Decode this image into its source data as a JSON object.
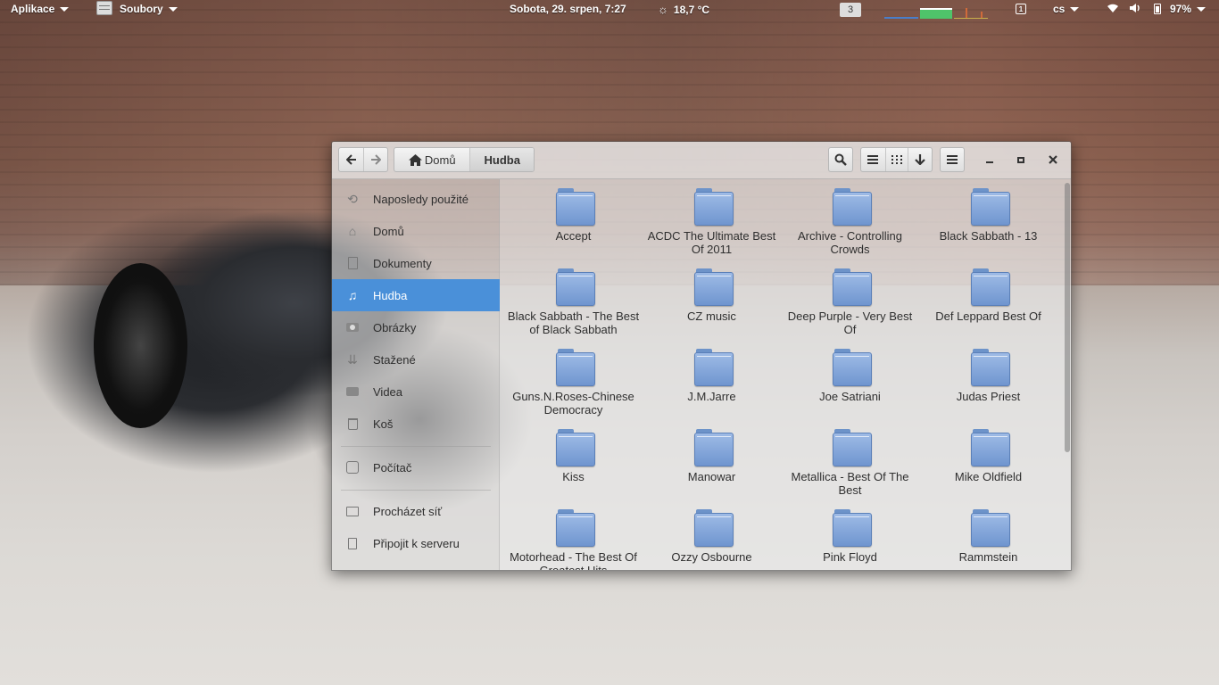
{
  "topbar": {
    "applications": "Aplikace",
    "files": "Soubory",
    "clock": "Sobota, 29. srpen,  7:27",
    "weather": "18,7 °C",
    "workspace": "3",
    "language": "cs",
    "battery": "97%"
  },
  "window": {
    "breadcrumb": {
      "home": "Domů",
      "current": "Hudba"
    }
  },
  "sidebar": {
    "items": [
      {
        "label": "Naposledy použité",
        "icon": "recent-icon"
      },
      {
        "label": "Domů",
        "icon": "home-icon"
      },
      {
        "label": "Dokumenty",
        "icon": "document-icon"
      },
      {
        "label": "Hudba",
        "icon": "music-icon"
      },
      {
        "label": "Obrázky",
        "icon": "camera-icon"
      },
      {
        "label": "Stažené",
        "icon": "download-icon"
      },
      {
        "label": "Videa",
        "icon": "video-icon"
      },
      {
        "label": "Koš",
        "icon": "trash-icon"
      },
      {
        "label": "Počítač",
        "icon": "computer-icon"
      },
      {
        "label": "Procházet síť",
        "icon": "network-icon"
      },
      {
        "label": "Připojit k serveru",
        "icon": "server-icon"
      }
    ]
  },
  "folders": [
    "Accept",
    "ACDC The Ultimate Best Of 2011",
    "Archive - Controlling Crowds",
    "Black Sabbath - 13",
    "Black Sabbath - The Best of Black Sabbath",
    "CZ music",
    "Deep Purple - Very Best Of",
    "Def Leppard Best Of",
    "Guns.N.Roses-Chinese Democracy",
    "J.M.Jarre",
    "Joe Satriani",
    "Judas Priest",
    "Kiss",
    "Manowar",
    "Metallica - Best Of The Best",
    "Mike Oldfield",
    "Motorhead - The Best Of Greatest Hits",
    "Ozzy Osbourne",
    "Pink Floyd",
    "Rammstein"
  ]
}
